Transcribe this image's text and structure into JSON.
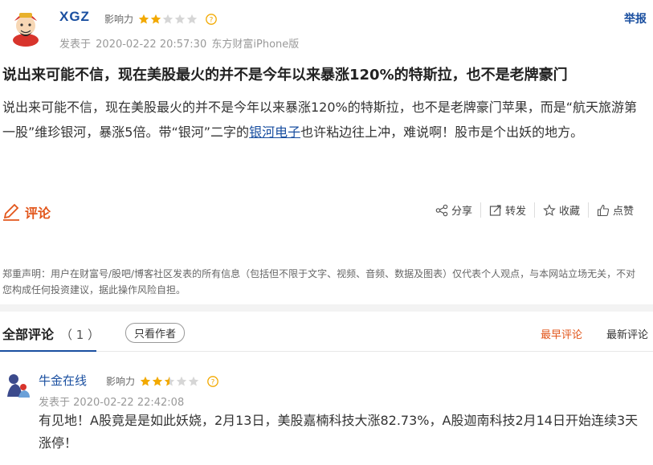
{
  "post": {
    "author": "XGZ",
    "influence_label": "影响力",
    "influence_stars": 2,
    "influence_max": 5,
    "posted_prefix": "发表于",
    "posted_time": "2020-02-22 20:57:30",
    "source": "东方财富iPhone版",
    "report_label": "举报",
    "title": "说出来可能不信，现在美股最火的并不是今年以来暴涨120%的特斯拉，也不是老牌豪门",
    "body_part1": "说出来可能不信，现在美股最火的并不是今年以来暴涨120%的特斯拉，也不是老牌豪门苹果，而是“航天旅游第一股”维珍银河，暴涨5倍。带“银河”二字的",
    "body_link": "银河电子",
    "body_part2": "也许粘边往上冲，难说啊！股市是个出妖的地方。"
  },
  "actions": {
    "comment_label": "评论",
    "share": "分享",
    "forward": "转发",
    "favorite": "收藏",
    "like": "点赞"
  },
  "disclaimer": "郑重声明：用户在财富号/股吧/博客社区发表的所有信息（包括但不限于文字、视频、音频、数据及图表）仅代表个人观点，与本网站立场无关，不对您构成任何投资建议，据此操作风险自担。",
  "comments_section": {
    "title": "全部评论",
    "count": "（ 1 ）",
    "author_only": "只看作者",
    "sort_earliest": "最早评论",
    "sort_latest": "最新评论"
  },
  "comments": [
    {
      "author": "牛金在线",
      "influence_label": "影响力",
      "influence_stars": 2.5,
      "posted_prefix": "发表于",
      "posted_time": "2020-02-22 22:42:08",
      "text": "有见地！A股竟是是如此妖娆，2月13日，美股嘉楠科技大涨82.73%，A股迦南科技2月14日开始连续3天涨停！"
    }
  ],
  "colors": {
    "link_blue": "#1a4fa0",
    "accent_orange": "#e2561b",
    "star_gold": "#f2a900"
  }
}
